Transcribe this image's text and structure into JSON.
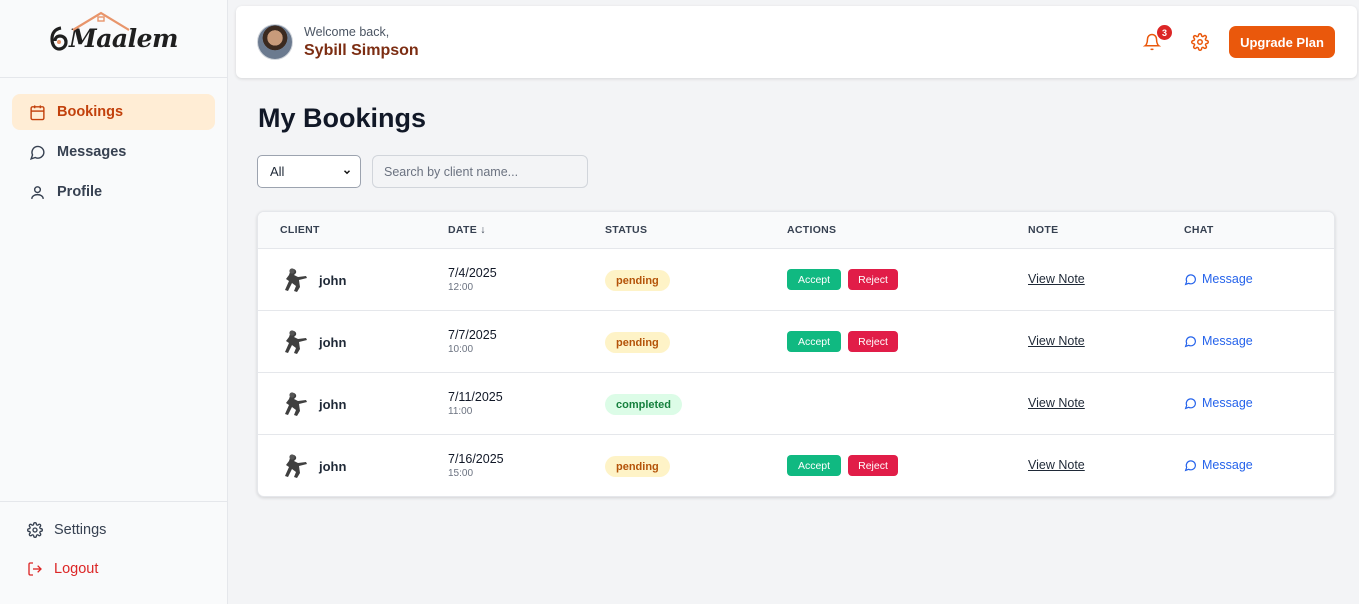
{
  "brand": {
    "logo_text": "Maalem"
  },
  "sidebar": {
    "items": [
      {
        "label": "Bookings",
        "icon": "calendar-icon",
        "active": true
      },
      {
        "label": "Messages",
        "icon": "message-circle-icon",
        "active": false
      },
      {
        "label": "Profile",
        "icon": "user-icon",
        "active": false
      }
    ],
    "bottom": [
      {
        "label": "Settings",
        "icon": "gear-icon"
      },
      {
        "label": "Logout",
        "icon": "logout-icon"
      }
    ]
  },
  "header": {
    "welcome": "Welcome back,",
    "user_name": "Sybill Simpson",
    "notification_count": "3",
    "upgrade_label": "Upgrade Plan",
    "accent_color": "#ea580c"
  },
  "main": {
    "title": "My Bookings",
    "filter_selected": "All",
    "search_placeholder": "Search by client name...",
    "columns": [
      "CLIENT",
      "DATE ↓",
      "STATUS",
      "ACTIONS",
      "NOTE",
      "CHAT"
    ],
    "rows": [
      {
        "client": "john",
        "date": "7/4/2025",
        "time": "12:00",
        "status": "pending",
        "accept": "Accept",
        "reject": "Reject",
        "note": "View Note",
        "chat": "Message"
      },
      {
        "client": "john",
        "date": "7/7/2025",
        "time": "10:00",
        "status": "pending",
        "accept": "Accept",
        "reject": "Reject",
        "note": "View Note",
        "chat": "Message"
      },
      {
        "client": "john",
        "date": "7/11/2025",
        "time": "11:00",
        "status": "completed",
        "accept": "",
        "reject": "",
        "note": "View Note",
        "chat": "Message"
      },
      {
        "client": "john",
        "date": "7/16/2025",
        "time": "15:00",
        "status": "pending",
        "accept": "Accept",
        "reject": "Reject",
        "note": "View Note",
        "chat": "Message"
      }
    ]
  }
}
